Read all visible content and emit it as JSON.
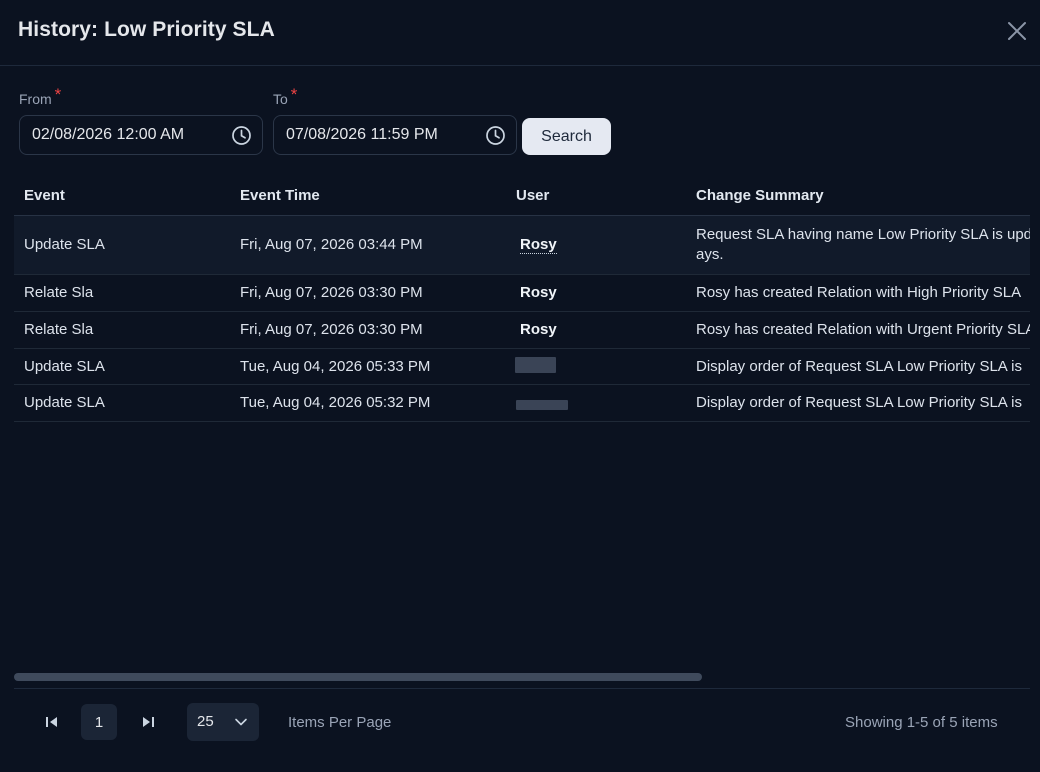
{
  "dialog": {
    "title": "History: Low Priority SLA"
  },
  "filters": {
    "from_label": "From",
    "to_label": "To",
    "required_mark": "*",
    "from_value": "02/08/2026 12:00 AM",
    "to_value": "07/08/2026 11:59 PM",
    "search_label": "Search"
  },
  "table": {
    "columns": [
      "Event",
      "Event Time",
      "User",
      "Change Summary"
    ],
    "rows": [
      {
        "event": "Update SLA",
        "time": "Fri, Aug 07, 2026 03:44 PM",
        "user": "Rosy",
        "summary_line1": "Request SLA having name Low Priority SLA is upd",
        "summary_line2": "ays."
      },
      {
        "event": "Relate Sla",
        "time": "Fri, Aug 07, 2026 03:30 PM",
        "user": "Rosy",
        "summary_line1": "Rosy has created Relation with High Priority SLA"
      },
      {
        "event": "Relate Sla",
        "time": "Fri, Aug 07, 2026 03:30 PM",
        "user": "Rosy",
        "summary_line1": "Rosy has created Relation with Urgent Priority SLA"
      },
      {
        "event": "Update SLA",
        "time": "Tue, Aug 04, 2026 05:33 PM",
        "user": "",
        "summary_line1": "Display order of Request SLA Low Priority SLA is"
      },
      {
        "event": "Update SLA",
        "time": "Tue, Aug 04, 2026 05:32 PM",
        "user": "",
        "summary_line1": "Display order of Request SLA Low Priority SLA is"
      }
    ]
  },
  "pagination": {
    "current_page": "1",
    "per_page": "25",
    "items_per_page_label": "Items Per Page",
    "showing": "Showing 1-5 of 5 items"
  },
  "colors": {
    "background": "#0b1220",
    "accent_button": "#e5e9f2",
    "required": "#ef4444"
  },
  "icons": [
    "close-icon",
    "clock-icon",
    "first-page-icon",
    "last-page-icon",
    "chevron-down-icon"
  ]
}
